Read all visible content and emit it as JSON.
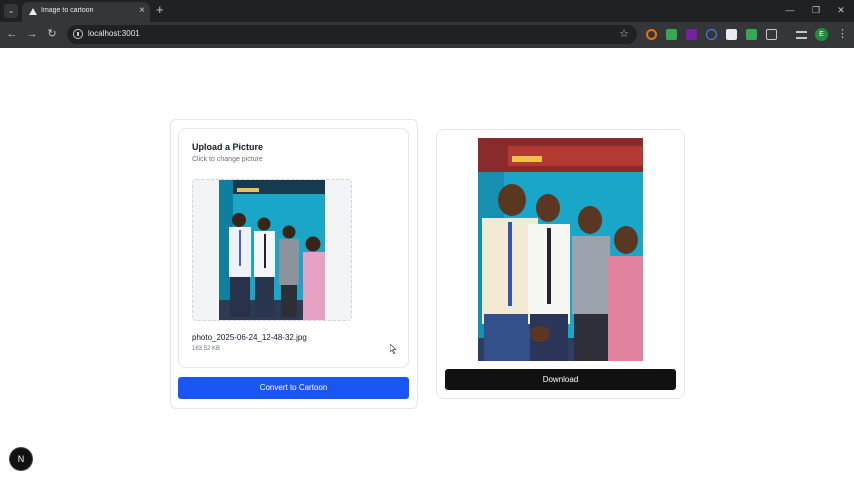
{
  "browser": {
    "tab_title": "Image to cartoon",
    "tab_list_icon": "chevron-down-icon",
    "tab_close_icon": "×",
    "new_tab_icon": "+",
    "window_controls": {
      "minimize": "—",
      "maximize": "❐",
      "close": "✕"
    },
    "nav": {
      "back": "←",
      "forward": "→",
      "reload": "↻"
    },
    "url": "localhost:3001",
    "star_icon": "☆",
    "profile_initial": "E",
    "menu_icon": "⋮",
    "extension_colors": [
      "#e8710a",
      "#34a853",
      "#7b1fa2",
      "#4285f4",
      "#e8eaed",
      "#34a853",
      "#c8c8c8",
      "#c8c8c8"
    ]
  },
  "upload": {
    "title": "Upload a Picture",
    "subtitle": "Click to change picture",
    "file_name": "photo_2025-06-24_12-48-32.jpg",
    "file_size": "163.52 KB",
    "convert_label": "Convert to Cartoon"
  },
  "result": {
    "download_label": "Download"
  },
  "dev_badge": "N",
  "colors": {
    "primary": "#1a56f5",
    "download": "#111111",
    "photo_wall": "#1aa6c9"
  }
}
